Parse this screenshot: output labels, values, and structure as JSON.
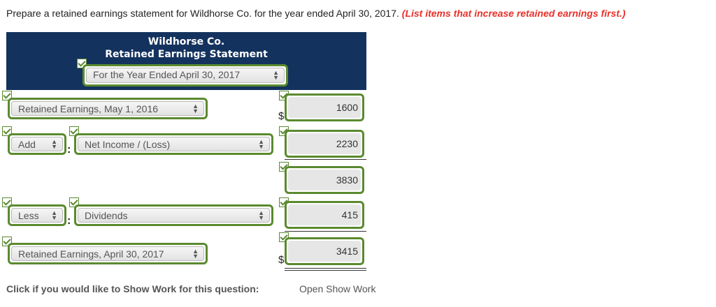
{
  "instructions": {
    "text": "Prepare a retained earnings statement for Wildhorse Co. for the year ended April 30, 2017.",
    "hint": "(List items that increase retained earnings first.)"
  },
  "header": {
    "company": "Wildhorse Co.",
    "statement_title": "Retained Earnings Statement",
    "period_select": "For the Year Ended April 30, 2017"
  },
  "rows": {
    "beginning": {
      "label": "Retained Earnings, May 1, 2016",
      "currency": "$",
      "amount": "1600"
    },
    "add": {
      "operator": "Add",
      "label": "Net Income / (Loss)",
      "amount": "2230"
    },
    "subtotal": {
      "amount": "3830"
    },
    "less": {
      "operator": "Less",
      "label": "Dividends",
      "amount": "415"
    },
    "ending": {
      "label": "Retained Earnings, April 30, 2017",
      "currency": "$",
      "amount": "3415"
    }
  },
  "separator": ":",
  "footer": {
    "label": "Click if you would like to Show Work for this question:",
    "link": "Open Show Work"
  },
  "colors": {
    "header_bg": "#14325e",
    "accent_green": "#5a8a2f",
    "hint_red": "#e8302a"
  },
  "icons": {
    "check": "check-icon",
    "select_arrows": "select-arrows-icon"
  }
}
